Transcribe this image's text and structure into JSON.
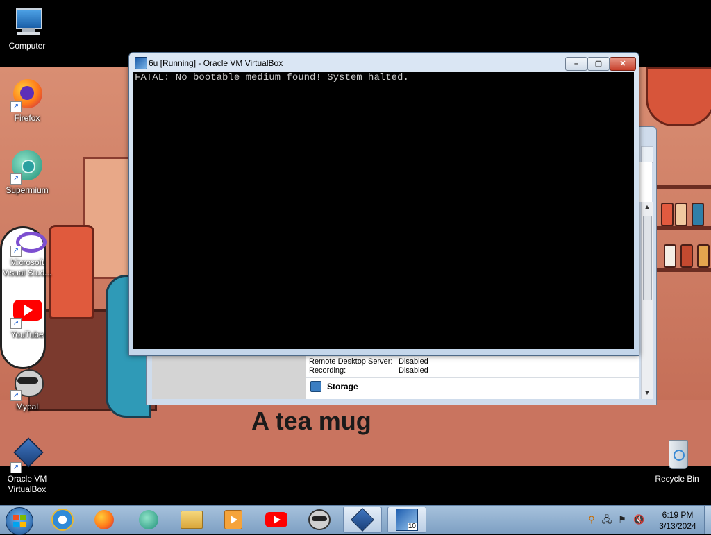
{
  "desktop": {
    "icons": [
      {
        "label": "Computer"
      },
      {
        "label": "Firefox"
      },
      {
        "label": "Supermium"
      },
      {
        "label": "Microsoft Visual Stud..."
      },
      {
        "label": "YouTube"
      },
      {
        "label": "Mypal"
      },
      {
        "label": "Oracle VM VirtualBox"
      },
      {
        "label": "Recycle Bin"
      }
    ],
    "wallpaper_caption": "A tea mug"
  },
  "vm_window": {
    "title": "6u [Running] - Oracle VM VirtualBox",
    "console_message": "FATAL: No bootable medium found! System halted.",
    "controls": {
      "minimize": "–",
      "maximize": "▢",
      "close": "✕"
    }
  },
  "manager_window": {
    "details": [
      {
        "label": "Remote Desktop Server:",
        "value": "Disabled"
      },
      {
        "label": "Recording:",
        "value": "Disabled"
      }
    ],
    "storage_section": "Storage"
  },
  "taskbar": {
    "pinned": [
      "Internet Explorer",
      "Firefox",
      "Supermium",
      "Windows Explorer",
      "Media Player",
      "YouTube",
      "Mypal",
      "Oracle VM VirtualBox",
      "VirtualBox VM"
    ],
    "vm_badge": "10",
    "clock_time": "6:19 PM",
    "clock_date": "3/13/2024"
  }
}
